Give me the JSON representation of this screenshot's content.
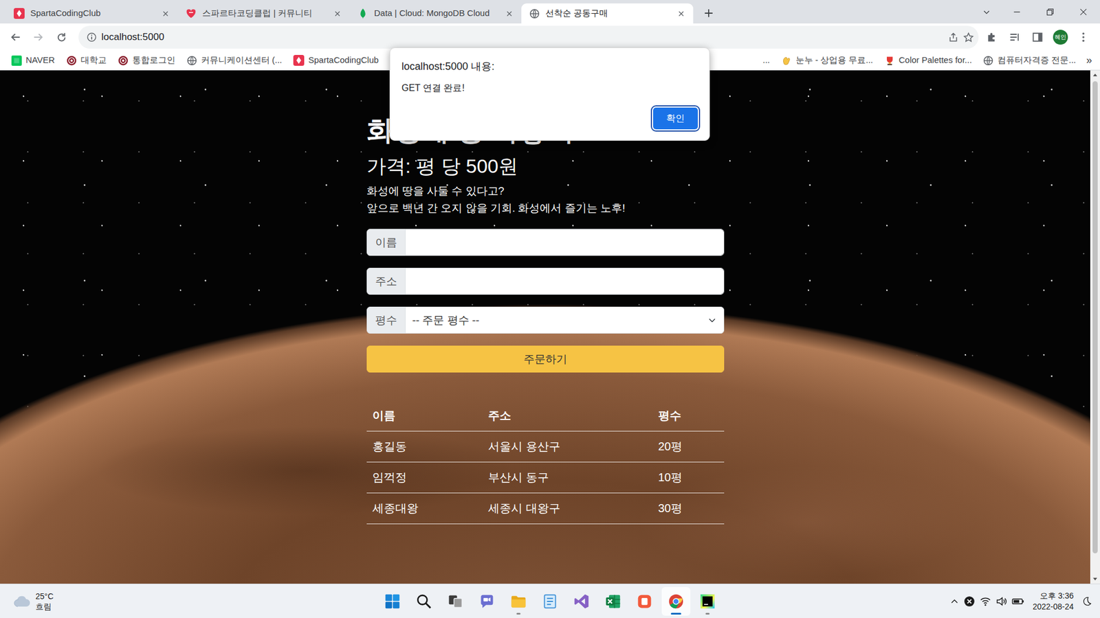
{
  "browser": {
    "tabs": [
      {
        "label": "SpartaCodingClub",
        "kind": "sparta",
        "selected": false
      },
      {
        "label": "스파르타코딩클럽 | 커뮤니티",
        "kind": "community",
        "selected": false
      },
      {
        "label": "Data | Cloud: MongoDB Cloud",
        "kind": "mongodb",
        "selected": false
      },
      {
        "label": "선착순 공동구매",
        "kind": "globe",
        "selected": true
      }
    ],
    "address": "localhost:5000",
    "profile": "혜인",
    "bookmarks": [
      {
        "label": "NAVER",
        "kind": "naver"
      },
      {
        "label": "대학교",
        "kind": "univ"
      },
      {
        "label": "통합로그인",
        "kind": "univ"
      },
      {
        "label": "커뮤니케이션센터 (...",
        "kind": "globe"
      },
      {
        "label": "SpartaCodingClub",
        "kind": "sparta"
      },
      {
        "label": "...",
        "kind": "hidden"
      },
      {
        "label": "눈누 - 상업용 무료...",
        "kind": "nunu"
      },
      {
        "label": "Color Palettes for...",
        "kind": "palette"
      },
      {
        "label": "컴퓨터자격증 전문...",
        "kind": "globe"
      }
    ],
    "bookmarks_more": "»"
  },
  "page": {
    "heading": "화성에 땅 사놓기!",
    "price": "가격: 평 당 500원",
    "intro": [
      "화성에 땅을 사둘 수 있다고?",
      "앞으로 백년 간 오지 않을 기회. 화성에서 즐기는 노후!"
    ],
    "form": {
      "fields": [
        {
          "label": "이름",
          "kind": "text",
          "value": ""
        },
        {
          "label": "주소",
          "kind": "text",
          "value": ""
        },
        {
          "label": "평수",
          "kind": "select",
          "value": "-- 주문 평수 --"
        }
      ],
      "submit": "주문하기"
    },
    "table": {
      "columns": [
        "이름",
        "주소",
        "평수"
      ],
      "rows": [
        [
          "홍길동",
          "서울시 용산구",
          "20평"
        ],
        [
          "임꺽정",
          "부산시 동구",
          "10평"
        ],
        [
          "세종대왕",
          "세종시 대왕구",
          "30평"
        ]
      ]
    }
  },
  "dialog": {
    "title": "localhost:5000 내용:",
    "message": "GET 연결 완료!",
    "button": "확인"
  },
  "taskbar": {
    "weather": {
      "temp": "25°C",
      "condition": "흐림"
    },
    "apps": [
      {
        "kind": "start",
        "running": false,
        "active": false
      },
      {
        "kind": "search",
        "running": false,
        "active": false
      },
      {
        "kind": "taskview",
        "running": false,
        "active": false
      },
      {
        "kind": "chat",
        "running": false,
        "active": false
      },
      {
        "kind": "explorer",
        "running": true,
        "active": false
      },
      {
        "kind": "notes",
        "running": false,
        "active": false
      },
      {
        "kind": "visualstudio",
        "running": false,
        "active": false
      },
      {
        "kind": "excel",
        "running": false,
        "active": false
      },
      {
        "kind": "redapp",
        "running": false,
        "active": false
      },
      {
        "kind": "chrome",
        "running": true,
        "active": true
      },
      {
        "kind": "pycharm",
        "running": true,
        "active": false
      }
    ],
    "time": "오후 3:36",
    "date": "2022-08-24"
  }
}
